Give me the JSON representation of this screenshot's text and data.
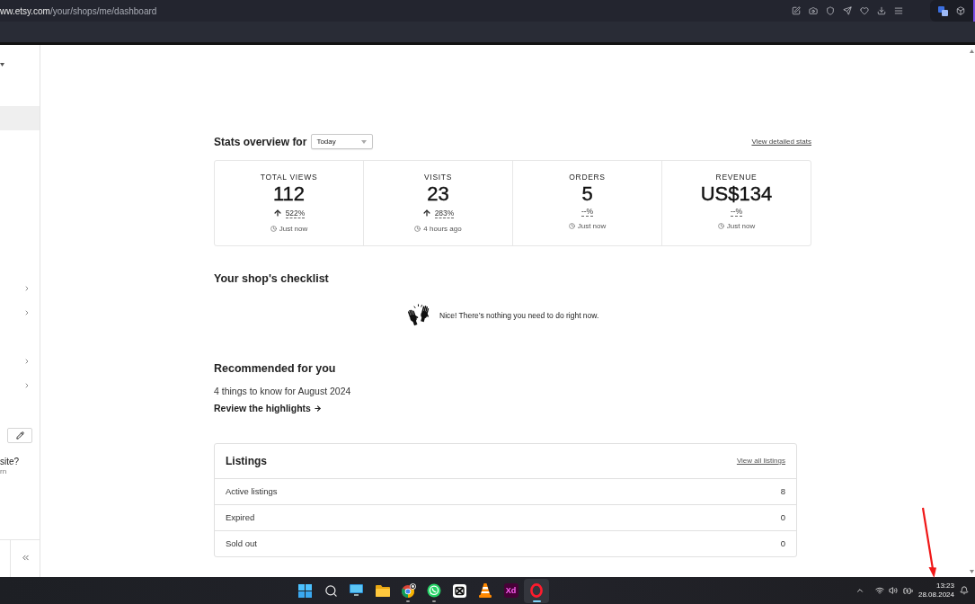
{
  "browser": {
    "url_host": "ww.etsy.com",
    "url_path": "/your/shops/me/dashboard"
  },
  "sidebar": {
    "nav_groups": [
      {
        "items": [
          {
            "selected": true,
            "expandable": false
          }
        ]
      },
      {
        "items": [
          {
            "selected": false,
            "expandable": true
          },
          {
            "selected": false,
            "expandable": true
          }
        ]
      },
      {
        "items": [
          {
            "selected": false,
            "expandable": true
          },
          {
            "selected": false,
            "expandable": true
          }
        ]
      }
    ],
    "question": "site?",
    "question_note": "rn"
  },
  "stats": {
    "title": "Stats overview for",
    "period": {
      "value": "Today"
    },
    "link": "View detailed stats",
    "metrics": [
      {
        "label": "TOTAL VIEWS",
        "value": "112",
        "change": "522%",
        "increase": true,
        "updated": "Just now"
      },
      {
        "label": "VISITS",
        "value": "23",
        "change": "283%",
        "increase": true,
        "updated": "4 hours ago"
      },
      {
        "label": "ORDERS",
        "value": "5",
        "change": "--%",
        "increase": false,
        "updated": "Just now"
      },
      {
        "label": "REVENUE",
        "value": "US$134",
        "change": "--%",
        "increase": false,
        "updated": "Just now"
      }
    ]
  },
  "checklist": {
    "title": "Your shop's checklist",
    "message": "Nice! There’s nothing you need to do right now."
  },
  "recommended": {
    "title": "Recommended for you",
    "text": "4 things to know for August 2024",
    "link": "Review the highlights"
  },
  "listings": {
    "title": "Listings",
    "link": "View all listings",
    "rows": [
      {
        "label": "Active listings",
        "count": "8"
      },
      {
        "label": "Expired",
        "count": "0"
      },
      {
        "label": "Sold out",
        "count": "0"
      }
    ]
  },
  "taskbar": {
    "apps": [
      {
        "kind": "start",
        "running": false,
        "selected": false
      },
      {
        "kind": "search",
        "running": false,
        "selected": false
      },
      {
        "kind": "desktop",
        "running": false,
        "selected": false
      },
      {
        "kind": "folder",
        "running": false,
        "selected": false
      },
      {
        "kind": "chrome",
        "running": true,
        "selected": false
      },
      {
        "kind": "whatsapp",
        "running": true,
        "selected": false
      },
      {
        "kind": "capcut",
        "running": false,
        "selected": false
      },
      {
        "kind": "vlc",
        "running": false,
        "selected": false
      },
      {
        "kind": "xd",
        "label": "Xd",
        "running": false,
        "selected": false
      },
      {
        "kind": "opera",
        "running": true,
        "selected": true
      }
    ],
    "time": "13:23",
    "date": "28.08.2024"
  }
}
